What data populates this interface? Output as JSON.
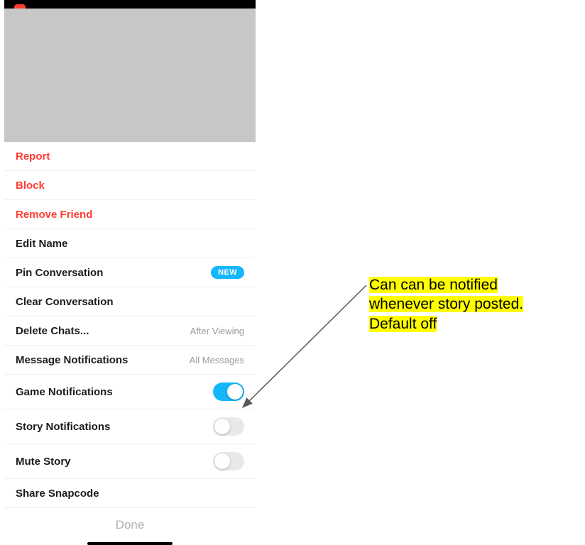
{
  "menu": {
    "items": [
      {
        "label": "Report",
        "danger": true
      },
      {
        "label": "Block",
        "danger": true
      },
      {
        "label": "Remove Friend",
        "danger": true
      },
      {
        "label": "Edit Name"
      },
      {
        "label": "Pin Conversation",
        "badge": "NEW"
      },
      {
        "label": "Clear Conversation"
      },
      {
        "label": "Delete Chats...",
        "value": "After Viewing"
      },
      {
        "label": "Message Notifications",
        "value": "All Messages"
      },
      {
        "label": "Game Notifications",
        "toggle": true,
        "on": true
      },
      {
        "label": "Story Notifications",
        "toggle": true,
        "on": false
      },
      {
        "label": "Mute Story",
        "toggle": true,
        "on": false
      },
      {
        "label": "Share Snapcode"
      }
    ],
    "done": "Done"
  },
  "annotation": {
    "line1": "Can can be notified",
    "line2": "whenever story posted.",
    "line3": "Default off"
  }
}
